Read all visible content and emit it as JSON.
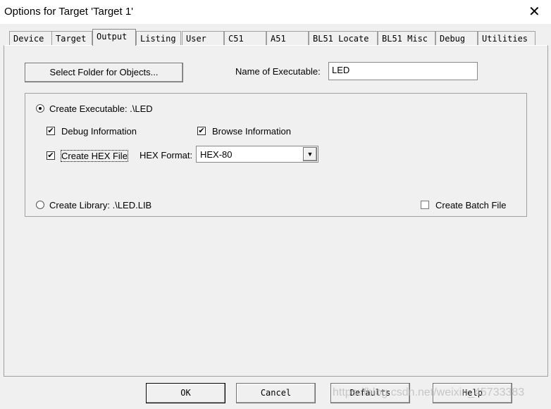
{
  "window": {
    "title": "Options for Target 'Target 1'",
    "close": "✕"
  },
  "tabs": [
    {
      "label": "Device"
    },
    {
      "label": "Target"
    },
    {
      "label": "Output",
      "active": true
    },
    {
      "label": "Listing"
    },
    {
      "label": "User"
    },
    {
      "label": "C51"
    },
    {
      "label": "A51"
    },
    {
      "label": "BL51 Locate"
    },
    {
      "label": "BL51 Misc"
    },
    {
      "label": "Debug"
    },
    {
      "label": "Utilities"
    }
  ],
  "output": {
    "select_folder": "Select Folder for Objects...",
    "name_label": "Name of Executable:",
    "name_value": "LED",
    "create_exe": {
      "label": "Create Executable:  .\\LED",
      "selected": true
    },
    "debug_info": {
      "label": "Debug Information",
      "checked": true
    },
    "browse_info": {
      "label": "Browse Information",
      "checked": true
    },
    "create_hex": {
      "label": "Create HEX File",
      "checked": true
    },
    "hex_format_label": "HEX Format:",
    "hex_format_value": "HEX-80",
    "create_lib": {
      "label": "Create Library:  .\\LED.LIB",
      "selected": false
    },
    "batch": {
      "label": "Create Batch File",
      "checked": false
    }
  },
  "buttons": {
    "ok": "OK",
    "cancel": "Cancel",
    "defaults": "Defaults",
    "help": "Help"
  },
  "watermark": "https://blog.csdn.net/weixin_45733383",
  "check_glyph": "✔"
}
